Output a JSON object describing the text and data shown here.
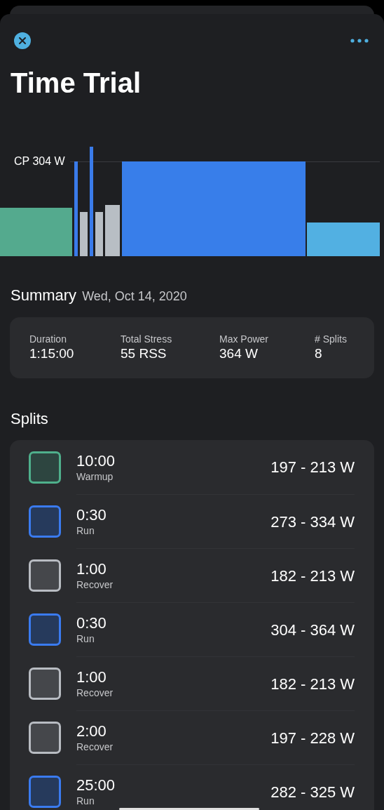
{
  "header": {
    "title": "Time Trial"
  },
  "chart": {
    "cp_label": "CP 304 W"
  },
  "summary": {
    "heading": "Summary",
    "date": "Wed, Oct 14, 2020",
    "stats": [
      {
        "label": "Duration",
        "value": "1:15:00"
      },
      {
        "label": "Total Stress",
        "value": "55 RSS"
      },
      {
        "label": "Max Power",
        "value": "364 W"
      },
      {
        "label": "# Splits",
        "value": "8"
      }
    ]
  },
  "splits": {
    "heading": "Splits",
    "items": [
      {
        "kind": "warmup",
        "color": "#4fb08c",
        "time": "10:00",
        "name": "Warmup",
        "range": "197 - 213 W"
      },
      {
        "kind": "run",
        "color": "#3a7bf0",
        "time": "0:30",
        "name": "Run",
        "range": "273 - 334 W"
      },
      {
        "kind": "recover",
        "color": "#b8bcc2",
        "time": "1:00",
        "name": "Recover",
        "range": "182 - 213 W"
      },
      {
        "kind": "run",
        "color": "#3a7bf0",
        "time": "0:30",
        "name": "Run",
        "range": "304 - 364 W"
      },
      {
        "kind": "recover",
        "color": "#b8bcc2",
        "time": "1:00",
        "name": "Recover",
        "range": "182 - 213 W"
      },
      {
        "kind": "recover",
        "color": "#b8bcc2",
        "time": "2:00",
        "name": "Recover",
        "range": "197 - 228 W"
      },
      {
        "kind": "run",
        "color": "#3a7bf0",
        "time": "25:00",
        "name": "Run",
        "range": "282 - 325 W"
      }
    ]
  }
}
